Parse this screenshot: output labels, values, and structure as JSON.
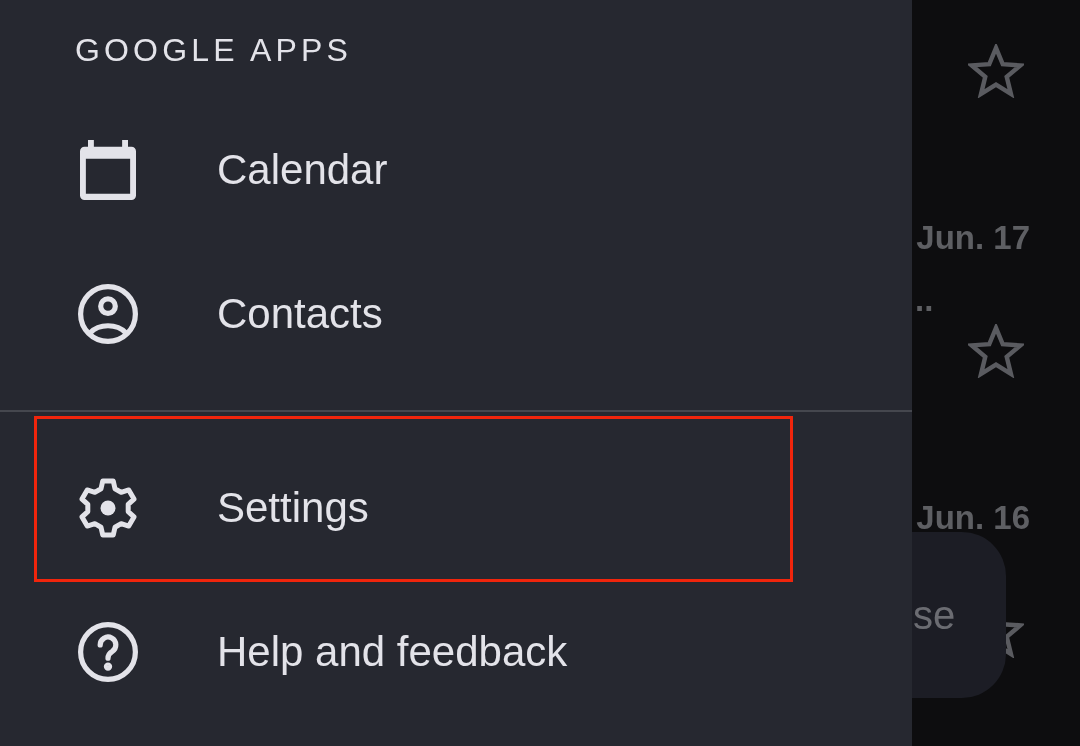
{
  "drawer": {
    "heading": "GOOGLE APPS",
    "sections": [
      {
        "items": [
          {
            "kind": "calendar",
            "label": "Calendar",
            "highlighted": false
          },
          {
            "kind": "contacts",
            "label": "Contacts",
            "highlighted": false
          }
        ]
      },
      {
        "items": [
          {
            "kind": "settings",
            "label": "Settings",
            "highlighted": true
          },
          {
            "kind": "help",
            "label": "Help and feedback",
            "highlighted": false
          }
        ]
      }
    ]
  },
  "background_list": {
    "rows": [
      {
        "starred": false
      },
      {
        "date": "Jun. 17",
        "snippet": "..",
        "starred": false
      },
      {
        "date": "Jun. 16",
        "starred": false
      }
    ]
  },
  "compose_button": {
    "label": "se"
  }
}
